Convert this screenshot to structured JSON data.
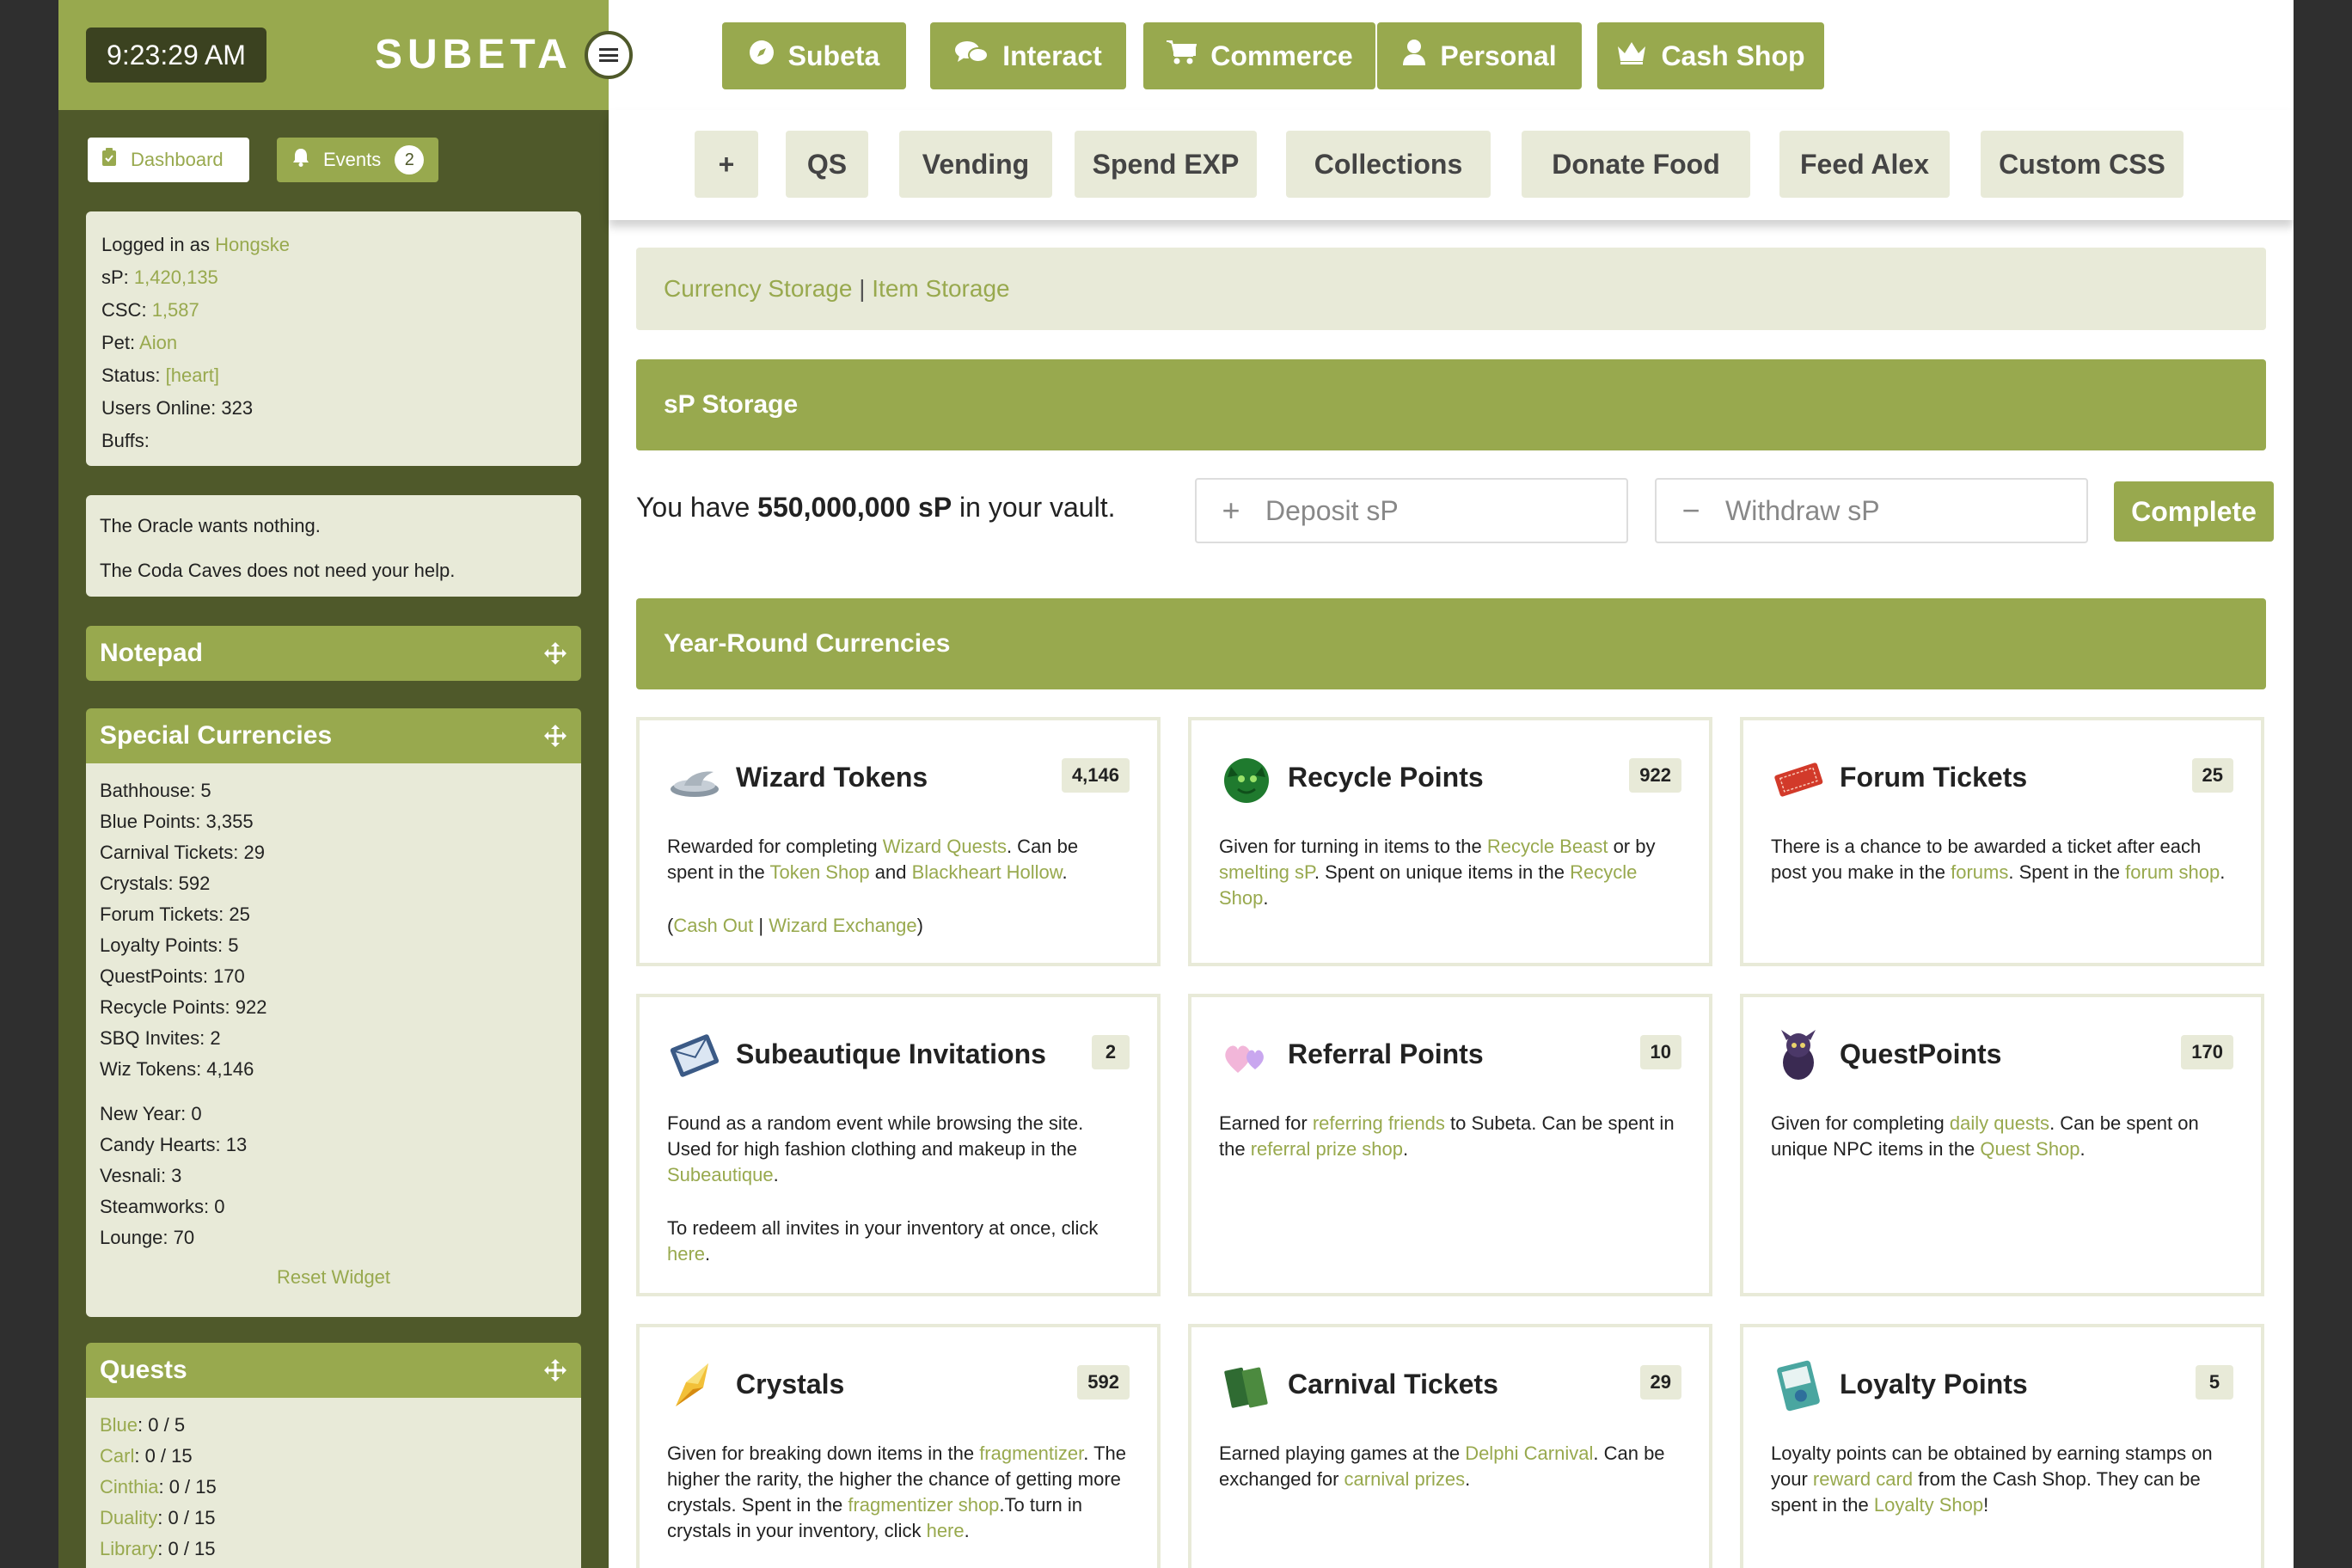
{
  "colors": {
    "accent": "#98a94e",
    "sidebar": "#4f592a",
    "panel": "#e8ead8",
    "link": "#98a94e"
  },
  "clock": "9:23:29 AM",
  "brand": "SUBETA",
  "nav": [
    {
      "label": "Subeta",
      "icon": "compass-icon"
    },
    {
      "label": "Interact",
      "icon": "chat-bubbles-icon"
    },
    {
      "label": "Commerce",
      "icon": "cart-icon"
    },
    {
      "label": "Personal",
      "icon": "user-icon"
    },
    {
      "label": "Cash Shop",
      "icon": "crown-icon"
    }
  ],
  "subnav": [
    "+",
    "QS",
    "Vending",
    "Spend EXP",
    "Collections",
    "Donate Food",
    "Feed Alex",
    "Custom CSS"
  ],
  "sidebar": {
    "dashboard_label": "Dashboard",
    "events_label": "Events",
    "events_count": "2",
    "user": {
      "logged_in_prefix": "Logged in as",
      "username": "Hongske",
      "sp_label": "sP:",
      "sp_value": "1,420,135",
      "csc_label": "CSC:",
      "csc_value": "1,587",
      "pet_label": "Pet:",
      "pet_value": "Aion",
      "status_label": "Status:",
      "status_value": "[heart]",
      "online_label": "Users Online: 323",
      "buffs_label": "Buffs:"
    },
    "oracle": [
      "The Oracle wants nothing.",
      "The Coda Caves does not need your help."
    ],
    "notepad_title": "Notepad",
    "special_title": "Special Currencies",
    "special_items": [
      "Bathhouse: 5",
      "Blue Points: 3,355",
      "Carnival Tickets: 29",
      "Crystals: 592",
      "Forum Tickets: 25",
      "Loyalty Points: 5",
      "QuestPoints: 170",
      "Recycle Points: 922",
      "SBQ Invites: 2",
      "Wiz Tokens: 4,146"
    ],
    "event_items": [
      "New Year: 0",
      "Candy Hearts: 13",
      "Vesnali: 3",
      "Steamworks: 0",
      "Lounge: 70"
    ],
    "reset_label": "Reset Widget",
    "quests_title": "Quests",
    "quests": [
      {
        "name": "Blue",
        "value": ": 0 / 5"
      },
      {
        "name": "Carl",
        "value": ": 0 / 15"
      },
      {
        "name": "Cinthia",
        "value": ": 0 / 15"
      },
      {
        "name": "Duality",
        "value": ": 0 / 15"
      },
      {
        "name": "Library",
        "value": ": 0 / 15"
      }
    ]
  },
  "main": {
    "storage_links": [
      "Currency Storage",
      "Item Storage"
    ],
    "storage_sep": "|",
    "sp_title": "sP Storage",
    "vault_prefix": "You have",
    "vault_amount": "550,000,000 sP",
    "vault_suffix": "in your vault.",
    "deposit_placeholder": "Deposit sP",
    "withdraw_placeholder": "Withdraw sP",
    "complete_label": "Complete",
    "year_round_title": "Year-Round Currencies",
    "cards": [
      {
        "title": "Wizard Tokens",
        "count": "4,146",
        "icon": "wizard-hat-icon",
        "body": [
          [
            [
              "t",
              "Rewarded for completing "
            ],
            [
              "l",
              "Wizard Quests"
            ],
            [
              "t",
              ". Can be spent in the "
            ],
            [
              "l",
              "Token Shop"
            ],
            [
              "t",
              " and "
            ],
            [
              "l",
              "Blackheart Hollow"
            ],
            [
              "t",
              "."
            ]
          ],
          [
            [
              "t",
              "("
            ],
            [
              "l",
              "Cash Out"
            ],
            [
              "t",
              " | "
            ],
            [
              "l",
              "Wizard Exchange"
            ],
            [
              "t",
              ")"
            ]
          ]
        ]
      },
      {
        "title": "Recycle Points",
        "count": "922",
        "icon": "recycle-beast-icon",
        "body": [
          [
            [
              "t",
              "Given for turning in items to the "
            ],
            [
              "l",
              "Recycle Beast"
            ],
            [
              "t",
              " or by "
            ],
            [
              "l",
              "smelting sP"
            ],
            [
              "t",
              ". Spent on unique items in the "
            ],
            [
              "l",
              "Recycle Shop"
            ],
            [
              "t",
              "."
            ]
          ]
        ]
      },
      {
        "title": "Forum Tickets",
        "count": "25",
        "icon": "ticket-icon",
        "body": [
          [
            [
              "t",
              "There is a chance to be awarded a ticket after each post you make in the "
            ],
            [
              "l",
              "forums"
            ],
            [
              "t",
              ". Spent in the "
            ],
            [
              "l",
              "forum shop"
            ],
            [
              "t",
              "."
            ]
          ]
        ]
      },
      {
        "title": "Subeautique Invitations",
        "count": "2",
        "icon": "invitation-icon",
        "body": [
          [
            [
              "t",
              "Found as a random event while browsing the site. Used for high fashion clothing and makeup in the "
            ],
            [
              "l",
              "Subeautique"
            ],
            [
              "t",
              "."
            ]
          ],
          [
            [
              "t",
              "To redeem all invites in your inventory at once, click "
            ],
            [
              "l",
              "here"
            ],
            [
              "t",
              "."
            ]
          ]
        ]
      },
      {
        "title": "Referral Points",
        "count": "10",
        "icon": "hearts-icon",
        "body": [
          [
            [
              "t",
              "Earned for "
            ],
            [
              "l",
              "referring friends"
            ],
            [
              "t",
              " to Subeta. Can be spent in the "
            ],
            [
              "l",
              "referral prize shop"
            ],
            [
              "t",
              "."
            ]
          ]
        ]
      },
      {
        "title": "QuestPoints",
        "count": "170",
        "icon": "quest-creature-icon",
        "body": [
          [
            [
              "t",
              "Given for completing "
            ],
            [
              "l",
              "daily quests"
            ],
            [
              "t",
              ". Can be spent on unique NPC items in the "
            ],
            [
              "l",
              "Quest Shop"
            ],
            [
              "t",
              "."
            ]
          ]
        ]
      },
      {
        "title": "Crystals",
        "count": "592",
        "icon": "crystal-icon",
        "body": [
          [
            [
              "t",
              "Given for breaking down items in the "
            ],
            [
              "l",
              "fragmentizer"
            ],
            [
              "t",
              ". The higher the rarity, the higher the chance of getting more crystals. Spent in the "
            ],
            [
              "l",
              "fragmentizer shop"
            ],
            [
              "t",
              ".To turn in crystals in your inventory, click "
            ],
            [
              "l",
              "here"
            ],
            [
              "t",
              "."
            ]
          ]
        ]
      },
      {
        "title": "Carnival Tickets",
        "count": "29",
        "icon": "carnival-ticket-icon",
        "body": [
          [
            [
              "t",
              "Earned playing games at the "
            ],
            [
              "l",
              "Delphi Carnival"
            ],
            [
              "t",
              ". Can be exchanged for "
            ],
            [
              "l",
              "carnival prizes"
            ],
            [
              "t",
              "."
            ]
          ]
        ]
      },
      {
        "title": "Loyalty Points",
        "count": "5",
        "icon": "loyalty-card-icon",
        "body": [
          [
            [
              "t",
              "Loyalty points can be obtained by earning stamps on your "
            ],
            [
              "l",
              "reward card"
            ],
            [
              "t",
              " from the Cash Shop. They can be spent in the "
            ],
            [
              "l",
              "Loyalty Shop"
            ],
            [
              "t",
              "!"
            ]
          ]
        ]
      }
    ]
  }
}
